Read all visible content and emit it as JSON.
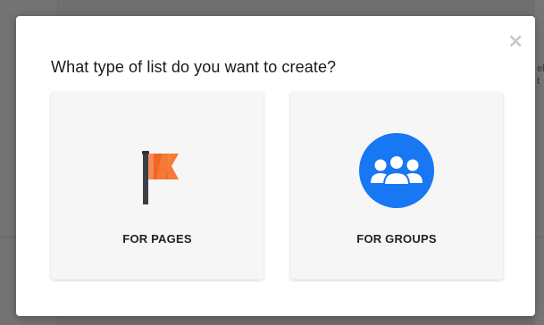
{
  "modal": {
    "title": "What type of list do you want to create?",
    "close_label": "×",
    "options": [
      {
        "label": "FOR PAGES",
        "icon": "flag-icon",
        "icon_color": "#f26522"
      },
      {
        "label": "FOR GROUPS",
        "icon": "group-icon",
        "icon_color": "#1877f2"
      }
    ]
  },
  "background": {
    "strip_text": "el\nt"
  },
  "colors": {
    "overlay": "#6f6f6f",
    "card": "#f6f6f6",
    "flag_orange": "#f26522",
    "groups_blue": "#1877f2"
  }
}
